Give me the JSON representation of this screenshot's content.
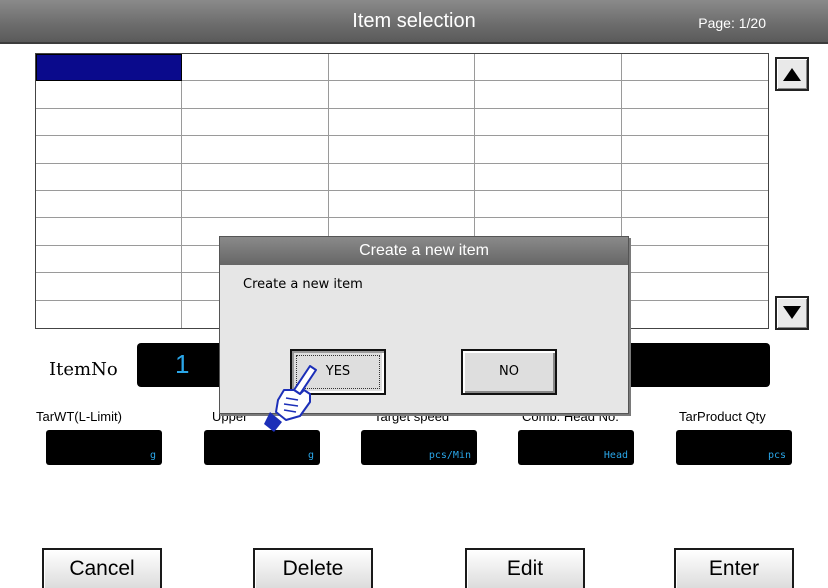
{
  "header": {
    "title": "Item selection",
    "page": "Page: 1/20"
  },
  "itemno": {
    "label": "ItemNo",
    "value": "1"
  },
  "fields": [
    {
      "label": "TarWT(L-Limit)",
      "unit": "g"
    },
    {
      "label": "Upper",
      "unit": "g"
    },
    {
      "label": "Target speed",
      "unit": "pcs/Min"
    },
    {
      "label": "Comb. Head No.",
      "unit": "Head"
    },
    {
      "label": "TarProduct Qty",
      "unit": "pcs"
    }
  ],
  "buttons": {
    "cancel": "Cancel",
    "delete": "Delete",
    "edit": "Edit",
    "enter": "Enter"
  },
  "dialog": {
    "title": "Create a new item",
    "message": "Create a new item",
    "yes": "YES",
    "no": "NO"
  },
  "colors": {
    "header": "#6e6e6e",
    "selected_cell": "#0a0a8c",
    "field_value": "#2aa6e8"
  },
  "icons": {
    "scroll_up": "triangle-up-icon",
    "scroll_down": "triangle-down-icon",
    "cursor": "pointing-hand-icon"
  }
}
